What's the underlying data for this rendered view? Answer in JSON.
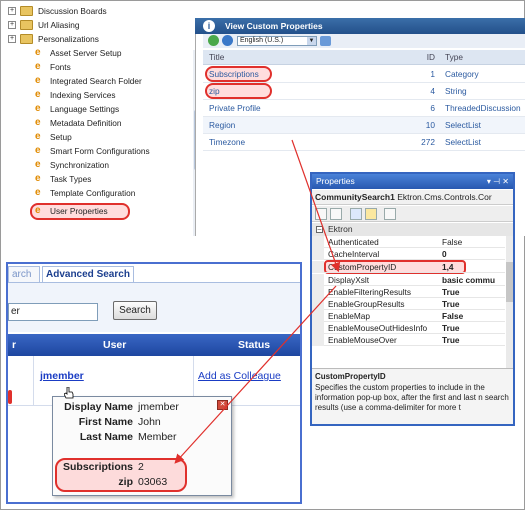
{
  "tree": {
    "items": [
      {
        "label": "Discussion Boards",
        "kind": "folder",
        "expand": "+"
      },
      {
        "label": "Url Aliasing",
        "kind": "folder",
        "expand": "+"
      },
      {
        "label": "Personalizations",
        "kind": "folder",
        "expand": "+"
      },
      {
        "label": "Asset Server Setup",
        "kind": "item"
      },
      {
        "label": "Fonts",
        "kind": "item"
      },
      {
        "label": "Integrated Search Folder",
        "kind": "item"
      },
      {
        "label": "Indexing Services",
        "kind": "item"
      },
      {
        "label": "Language Settings",
        "kind": "item"
      },
      {
        "label": "Metadata Definition",
        "kind": "item"
      },
      {
        "label": "Setup",
        "kind": "item"
      },
      {
        "label": "Smart Form Configurations",
        "kind": "item"
      },
      {
        "label": "Synchronization",
        "kind": "item"
      },
      {
        "label": "Task Types",
        "kind": "item"
      },
      {
        "label": "Template Configuration",
        "kind": "item"
      },
      {
        "label": "User Properties",
        "kind": "item",
        "highlight": true
      }
    ]
  },
  "custom_properties": {
    "title": "View Custom Properties",
    "language": "English (U.S.)",
    "columns": {
      "title": "Title",
      "id": "ID",
      "type": "Type"
    },
    "rows": [
      {
        "title": "Subscriptions",
        "id": "1",
        "type": "Category",
        "highlight": true
      },
      {
        "title": "zip",
        "id": "4",
        "type": "String",
        "highlight": true
      },
      {
        "title": "Private Profile",
        "id": "6",
        "type": "ThreadedDiscussion"
      },
      {
        "title": "Region",
        "id": "10",
        "type": "SelectList"
      },
      {
        "title": "Timezone",
        "id": "272",
        "type": "SelectList"
      }
    ]
  },
  "properties": {
    "title": "Properties",
    "title_buttons": "▾ ⊣ ✕",
    "object_name": "CommunitySearch1",
    "object_type": "Ektron.Cms.Controls.Cor",
    "category": "Ektron",
    "rows": [
      {
        "name": "Authenticated",
        "value": "False",
        "bold": false
      },
      {
        "name": "CacheInterval",
        "value": "0",
        "bold": false
      },
      {
        "name": "CustomPropertyID",
        "value": "1,4",
        "bold": true,
        "highlight": true
      },
      {
        "name": "DisplayXslt",
        "value": "basic commu",
        "bold": true
      },
      {
        "name": "EnableFilteringResults",
        "value": "True",
        "bold": true
      },
      {
        "name": "EnableGroupResults",
        "value": "True",
        "bold": true
      },
      {
        "name": "EnableMap",
        "value": "False",
        "bold": true
      },
      {
        "name": "EnableMouseOutHidesInfo",
        "value": "True",
        "bold": true
      },
      {
        "name": "EnableMouseOver",
        "value": "True",
        "bold": true
      }
    ],
    "desc_title": "CustomPropertyID",
    "desc_text": "Specifies the custom properties to include in the information pop-up box, after the first and last n search results (use a comma-delimiter for more t"
  },
  "community_search": {
    "tab_basic": "arch",
    "tab_advanced": "Advanced Search",
    "search_value": "er",
    "search_button": "Search",
    "columns": {
      "left": "r",
      "user": "User",
      "status": "Status"
    },
    "row": {
      "user_link": "jmember",
      "action_link": "Add as Colleague"
    },
    "popup": {
      "fields": [
        {
          "key": "Display Name",
          "value": "jmember"
        },
        {
          "key": "First Name",
          "value": "John"
        },
        {
          "key": "Last Name",
          "value": "Member"
        },
        {
          "key": "Subscriptions",
          "value": "2",
          "highlight": true
        },
        {
          "key": "zip",
          "value": "03063",
          "highlight": true
        }
      ]
    }
  },
  "colors": {
    "highlight_red": "#e0302c",
    "link_blue": "#1a3cc4",
    "header_blue": "#1d46a0",
    "frame_blue": "#4a6fd0"
  }
}
